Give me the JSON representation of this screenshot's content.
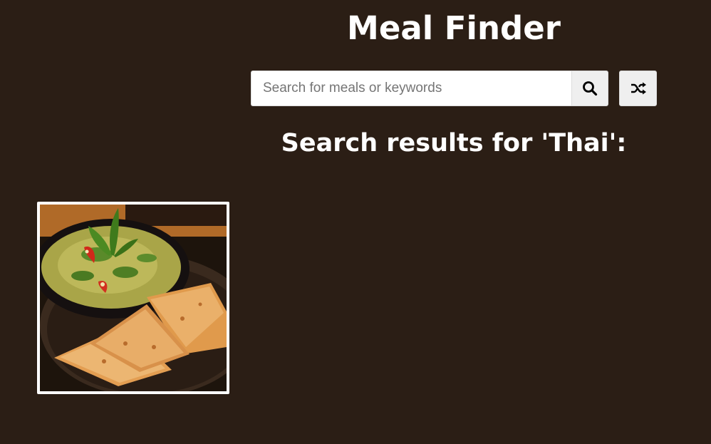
{
  "app": {
    "title": "Meal Finder"
  },
  "search": {
    "placeholder": "Search for meals or keywords",
    "value": "",
    "search_icon": "search-icon",
    "random_icon": "shuffle-icon"
  },
  "results": {
    "heading": "Search results for 'Thai':",
    "meals": [
      {
        "image": "green-curry-with-roti-photo"
      }
    ]
  },
  "colors": {
    "background": "#2b1e15",
    "text": "#ffffff",
    "button_bg": "#efefef",
    "card_border": "#ffffff"
  }
}
